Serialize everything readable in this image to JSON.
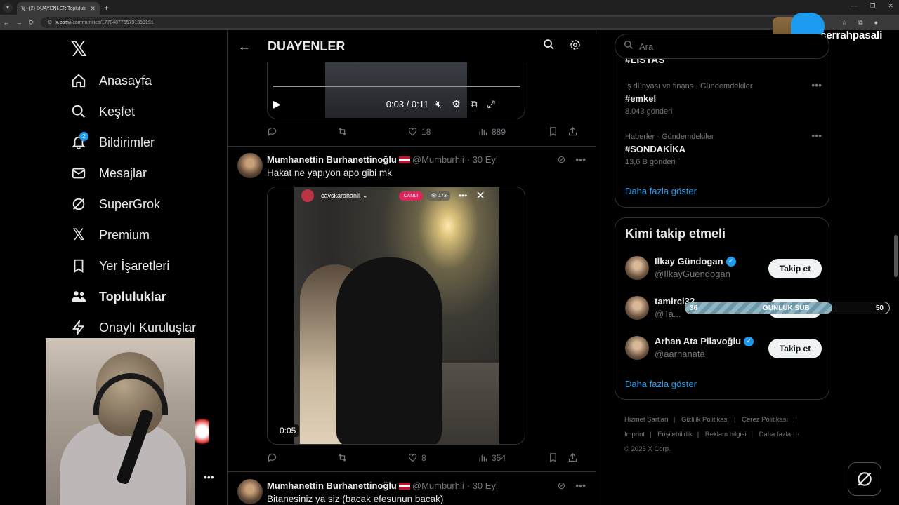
{
  "browser": {
    "tab_title": "(2) DUAYENLER Topluluk / X",
    "url_domain": "x.com",
    "url_path": "/i/communities/1770407765791359191"
  },
  "nav": {
    "items": [
      {
        "label": "Anasayfa",
        "icon": "home-icon"
      },
      {
        "label": "Keşfet",
        "icon": "search-icon"
      },
      {
        "label": "Bildirimler",
        "icon": "bell-icon",
        "badge": "2"
      },
      {
        "label": "Mesajlar",
        "icon": "mail-icon"
      },
      {
        "label": "SuperGrok",
        "icon": "grok-icon"
      },
      {
        "label": "Premium",
        "icon": "x-icon"
      },
      {
        "label": "Yer İşaretleri",
        "icon": "bookmark-icon"
      },
      {
        "label": "Topluluklar",
        "icon": "communities-icon",
        "active": true
      },
      {
        "label": "Onaylı Kuruluşlar",
        "icon": "lightning-icon"
      }
    ],
    "more_glyph": "•••"
  },
  "header": {
    "title": "DUAYENLER"
  },
  "tweet1": {
    "video_time": "0:03 / 0:11",
    "replies": "",
    "retweets": "",
    "likes": "18",
    "views": "889"
  },
  "tweet2": {
    "name": "Mumhanettin Burhanettinoğlu",
    "handle": "@Mumburhii",
    "date": "· 30 Eyl",
    "text": "Hakat ne yapıyon apo gibi mk",
    "live": {
      "username": "cavskarahanli",
      "badge": "CANLI",
      "viewers": "173"
    },
    "duration": "0:05",
    "likes": "8",
    "views": "354"
  },
  "tweet3": {
    "name": "Mumhanettin Burhanettinoğlu",
    "handle": "@Mumburhii",
    "date": "· 30 Eyl",
    "text": "Bitanesiniz ya siz (bacak efesunun bacak)"
  },
  "search": {
    "placeholder": "Ara"
  },
  "trends": {
    "cut_title": "#LISTAS",
    "items": [
      {
        "meta": "İş dünyası ve finans · Gündemdekiler",
        "name": "#emkel",
        "count": "8.043 gönderi"
      },
      {
        "meta": "Haberler · Gündemdekiler",
        "name": "#SONDAKİKA",
        "count": "13,6 B gönderi"
      }
    ],
    "show_more": "Daha fazla göster"
  },
  "who_to_follow": {
    "title": "Kimi takip etmeli",
    "users": [
      {
        "name": "Ilkay Gündogan",
        "handle": "@IlkayGuendogan",
        "verified": true,
        "button": "Takip et"
      },
      {
        "name": "tamirci32",
        "handle": "@Ta...",
        "verified": false,
        "button": "Takip et"
      },
      {
        "name": "Arhan Ata Pilavoğlu",
        "handle": "@aarhanata",
        "verified": true,
        "button": "Takip et"
      }
    ],
    "show_more": "Daha fazla göster"
  },
  "footer": {
    "links": [
      "Hizmet Şartları",
      "Gizlilik Politikası",
      "Çerez Politikası",
      "Imprint",
      "Erişilebilirlik",
      "Reklam bilgisi",
      "Daha fazla ···"
    ],
    "copyright": "© 2025 X Corp."
  },
  "overlay": {
    "sub_min": "36",
    "sub_label": "GÜNLÜK SUB",
    "sub_max": "50",
    "sub_progress": 0.72,
    "brand": "cerrahpasali"
  },
  "colors": {
    "accent": "#1d9bf0",
    "background": "#000000",
    "muted": "#71767b",
    "live": "#e0245e"
  }
}
